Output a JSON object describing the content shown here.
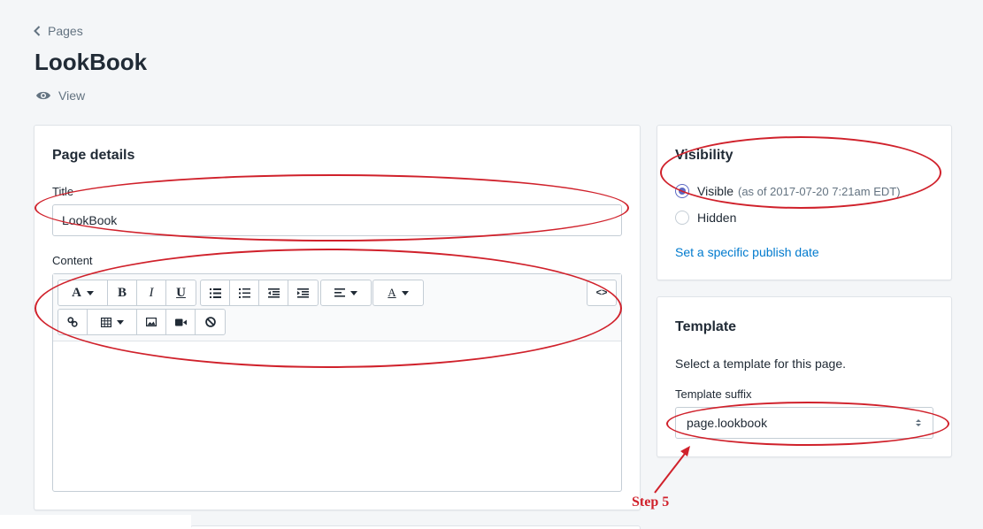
{
  "header": {
    "breadcrumb": "Pages",
    "title": "LookBook",
    "view_label": "View"
  },
  "page_details": {
    "card_title": "Page details",
    "title_label": "Title",
    "title_value": "LookBook",
    "content_label": "Content",
    "toolbar": {
      "row1": [
        "font-format",
        "bold",
        "italic",
        "underline",
        "bullet-list",
        "numbered-list",
        "outdent",
        "indent",
        "align",
        "text-color",
        "show-html"
      ],
      "row2": [
        "insert-link",
        "insert-table",
        "insert-image",
        "insert-video",
        "clear-formatting"
      ],
      "bold_glyph": "B",
      "italic_glyph": "I",
      "underline_glyph": "U",
      "font_glyph": "A",
      "color_glyph": "A",
      "html_glyph": "<>"
    }
  },
  "visibility": {
    "card_title": "Visibility",
    "options": [
      {
        "label": "Visible",
        "note": "(as of 2017-07-20 7:21am EDT)",
        "checked": true
      },
      {
        "label": "Hidden",
        "note": "",
        "checked": false
      }
    ],
    "publish_link": "Set a specific publish date"
  },
  "template": {
    "card_title": "Template",
    "description": "Select a template for this page.",
    "suffix_label": "Template suffix",
    "suffix_value": "page.lookbook"
  },
  "annotation": {
    "step_label": "Step 5",
    "color": "#d0212b"
  },
  "colors": {
    "background": "#f4f6f8",
    "link": "#007ace",
    "radio_accent": "#5c6ac4"
  }
}
